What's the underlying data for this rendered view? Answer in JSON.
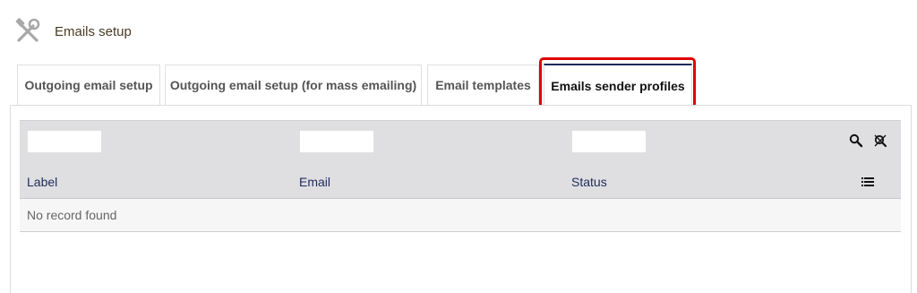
{
  "header": {
    "title": "Emails setup",
    "icon": "tools-icon"
  },
  "tabs": [
    {
      "label": "Outgoing email setup",
      "active": false
    },
    {
      "label": "Outgoing email setup (for mass emailing)",
      "active": false
    },
    {
      "label": "Email templates",
      "active": false
    },
    {
      "label": "Emails sender profiles",
      "active": true
    }
  ],
  "table": {
    "filters": [
      {
        "value": "",
        "placeholder": ""
      },
      {
        "value": "",
        "placeholder": ""
      },
      {
        "value": "",
        "placeholder": ""
      }
    ],
    "columns": [
      "Label",
      "Email",
      "Status"
    ],
    "empty_message": "No record found",
    "icons": [
      "search-icon",
      "clear-filter-icon",
      "list-icon"
    ]
  },
  "colors": {
    "highlight": "#e00000",
    "header_bg": "#dfdfe2",
    "column_text": "#1f2a5a"
  }
}
